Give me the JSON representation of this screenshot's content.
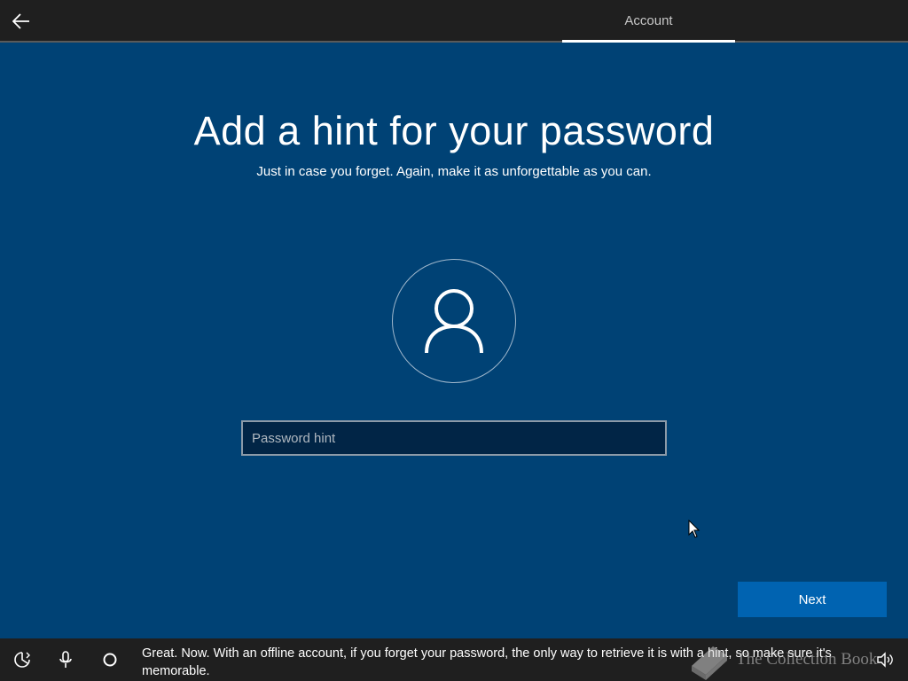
{
  "header": {
    "back_icon": "arrow-left-icon",
    "active_tab": "Account"
  },
  "main": {
    "title": "Add a hint for your password",
    "subtitle": "Just in case you forget. Again, make it as unforgettable as you can.",
    "avatar_icon": "user-icon",
    "hint_input": {
      "placeholder": "Password hint",
      "value": ""
    },
    "next_label": "Next"
  },
  "footer": {
    "ease_of_access_icon": "ease-of-access-icon",
    "microphone_icon": "microphone-icon",
    "cortana_icon": "cortana-circle-icon",
    "caption": "Great. Now. With an offline account, if you forget your password, the only way to retrieve it is with a hint, so make sure it's memorable.",
    "volume_icon": "volume-icon",
    "watermark_text": "The Collection Book"
  },
  "colors": {
    "background": "#004275",
    "bar": "#1f1f1f",
    "accent_button": "#0063b1",
    "input_background": "#012546"
  }
}
